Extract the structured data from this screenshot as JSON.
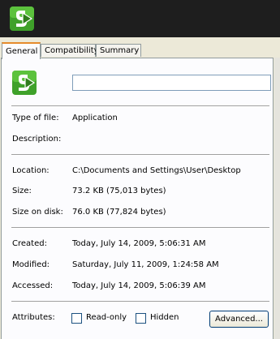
{
  "tabs": [
    {
      "label": "General"
    },
    {
      "label": "Compatibility"
    },
    {
      "label": "Summary"
    }
  ],
  "name_field": {
    "value": ""
  },
  "icons": {
    "app": "application-icon",
    "file": "file-icon"
  },
  "fields": {
    "type_label": "Type of file:",
    "type_value": "Application",
    "description_label": "Description:",
    "description_value": "",
    "location_label": "Location:",
    "location_value": "C:\\Documents and Settings\\User\\Desktop",
    "size_label": "Size:",
    "size_value": "73.2 KB (75,013 bytes)",
    "size_on_disk_label": "Size on disk:",
    "size_on_disk_value": "76.0 KB (77,824 bytes)",
    "created_label": "Created:",
    "created_value": "Today, July 14, 2009, 5:06:31 AM",
    "modified_label": "Modified:",
    "modified_value": "Saturday, July 11, 2009, 1:24:58 AM",
    "accessed_label": "Accessed:",
    "accessed_value": "Today, July 14, 2009, 5:06:39 AM"
  },
  "attributes": {
    "label": "Attributes:",
    "readonly_label": "Read-only",
    "readonly_checked": false,
    "hidden_label": "Hidden",
    "hidden_checked": false,
    "advanced_button": "Advanced..."
  },
  "colors": {
    "tab_accent": "#e68b2c",
    "dialog_bg": "#ece9d8",
    "icon_green": "#3fa12a"
  }
}
